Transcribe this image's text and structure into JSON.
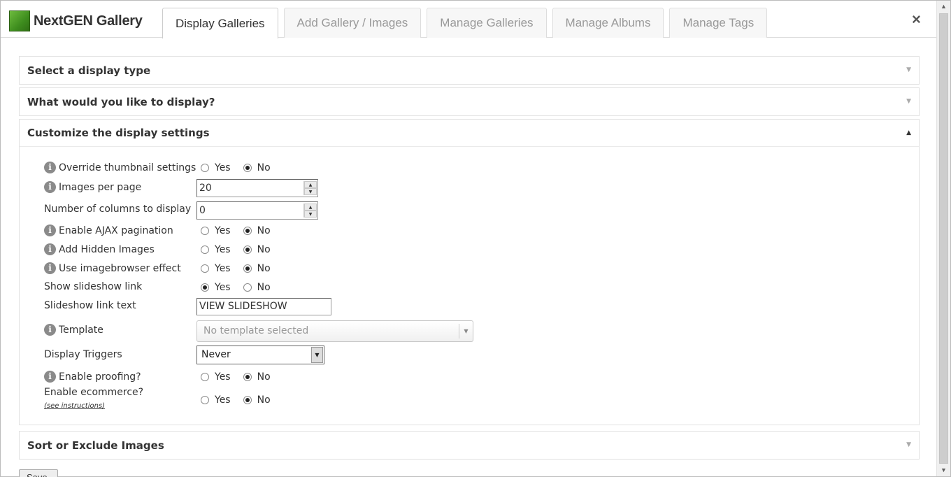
{
  "app": {
    "logo_text": "NextGEN Gallery",
    "close_symbol": "×"
  },
  "tabs": [
    {
      "label": "Display Galleries",
      "active": true
    },
    {
      "label": "Add Gallery / Images",
      "active": false
    },
    {
      "label": "Manage Galleries",
      "active": false
    },
    {
      "label": "Manage Albums",
      "active": false
    },
    {
      "label": "Manage Tags",
      "active": false
    }
  ],
  "sections": {
    "display_type": {
      "title": "Select a display type"
    },
    "what_display": {
      "title": "What would you like to display?"
    },
    "customize": {
      "title": "Customize the display settings"
    },
    "sort_exclude": {
      "title": "Sort or Exclude Images"
    }
  },
  "settings": {
    "override_thumbnail": {
      "label": "Override thumbnail settings",
      "yes": "Yes",
      "no": "No",
      "value": "No"
    },
    "images_per_page": {
      "label": "Images per page",
      "value": "20"
    },
    "num_columns": {
      "label": "Number of columns to display",
      "value": "0"
    },
    "ajax_pagination": {
      "label": "Enable AJAX pagination",
      "yes": "Yes",
      "no": "No",
      "value": "No"
    },
    "hidden_images": {
      "label": "Add Hidden Images",
      "yes": "Yes",
      "no": "No",
      "value": "No"
    },
    "imagebrowser": {
      "label": "Use imagebrowser effect",
      "yes": "Yes",
      "no": "No",
      "value": "No"
    },
    "slideshow_link": {
      "label": "Show slideshow link",
      "yes": "Yes",
      "no": "No",
      "value": "Yes"
    },
    "slideshow_link_text": {
      "label": "Slideshow link text",
      "value": "VIEW SLIDESHOW"
    },
    "template": {
      "label": "Template",
      "placeholder": "No template selected"
    },
    "display_triggers": {
      "label": "Display Triggers",
      "value": "Never"
    },
    "proofing": {
      "label": "Enable proofing?",
      "yes": "Yes",
      "no": "No",
      "value": "No"
    },
    "ecommerce": {
      "label": "Enable ecommerce?",
      "link": "(see instructions)",
      "yes": "Yes",
      "no": "No",
      "value": "No"
    }
  },
  "footer": {
    "save_label": "Save"
  },
  "icons": {
    "info": "i",
    "arrow_down": "▼",
    "arrow_up": "▲"
  }
}
